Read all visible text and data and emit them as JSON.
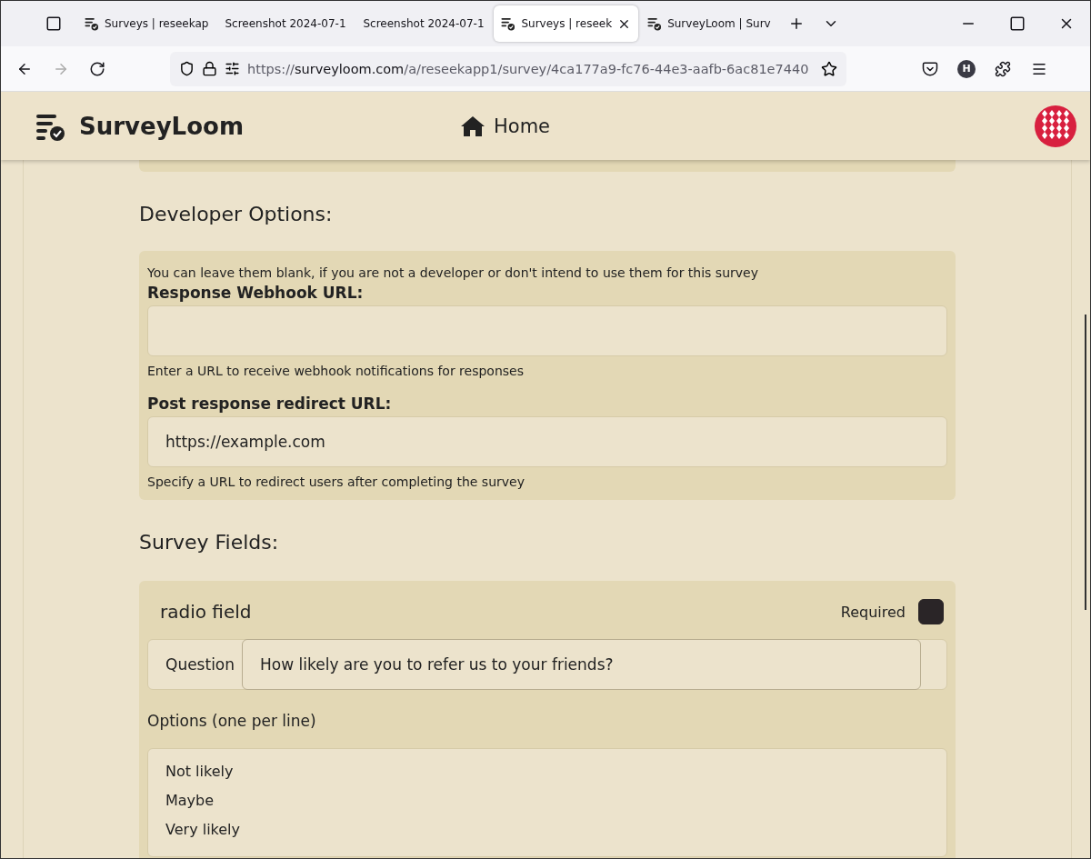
{
  "browser": {
    "tabs": [
      {
        "title": "Surveys | reseekap",
        "icon": true,
        "selected": false,
        "closable": false
      },
      {
        "title": "Screenshot 2024-07-1",
        "icon": false,
        "selected": false,
        "closable": false
      },
      {
        "title": "Screenshot 2024-07-1",
        "icon": false,
        "selected": false,
        "closable": false
      },
      {
        "title": "Surveys | reseek",
        "icon": true,
        "selected": true,
        "closable": true
      },
      {
        "title": "SurveyLoom | Surv",
        "icon": true,
        "selected": false,
        "closable": false
      }
    ],
    "address": {
      "scheme": "https://",
      "host": "surveyloom.com",
      "path": "/a/reseekapp1/survey/4ca177a9-fc76-44e3-aafb-6ac81e7440"
    },
    "profile_initial": "H"
  },
  "header": {
    "brand": "SurveyLoom",
    "nav": "Home"
  },
  "developer_options": {
    "heading": "Developer Options:",
    "note": "You can leave them blank, if you are not a developer or don't intend to use them for this survey",
    "fields": [
      {
        "label": "Response Webhook URL:",
        "help": "Enter a URL to receive webhook notifications for responses"
      },
      {
        "label": "Post response redirect URL:",
        "value": "https://example.com",
        "help": "Specify a URL to redirect users after completing the survey"
      }
    ]
  },
  "survey_fields": {
    "heading": "Survey Fields:",
    "items": [
      {
        "type": "radio field",
        "required_label": "Required",
        "required": true,
        "question_label": "Question",
        "question": "How likely are you to refer us to your friends?",
        "options_label": "Options (one per line)",
        "options": [
          "Not likely",
          "Maybe",
          "Very likely"
        ]
      }
    ]
  }
}
